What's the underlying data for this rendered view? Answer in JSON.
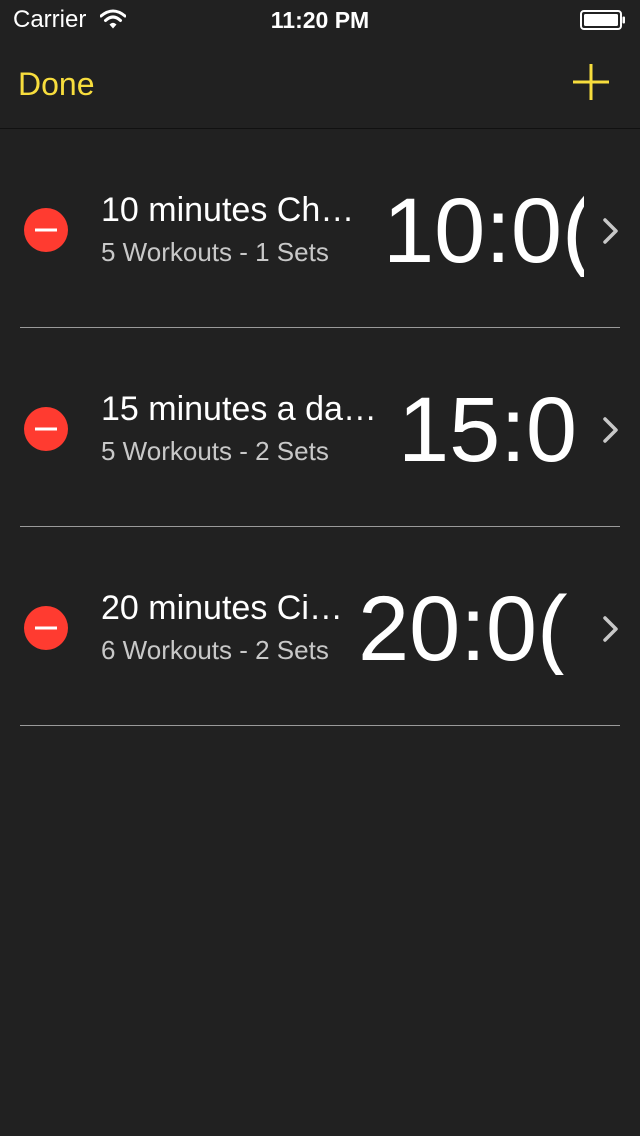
{
  "status_bar": {
    "carrier": "Carrier",
    "time": "11:20 PM",
    "icons": [
      "wifi-icon",
      "battery-icon"
    ]
  },
  "nav": {
    "done_label": "Done",
    "add_icon": "plus-icon",
    "accent_color": "#f7dd3d"
  },
  "colors": {
    "background": "#212121",
    "delete": "#ff3b30",
    "separator": "#9a9a9a"
  },
  "workouts": [
    {
      "title": "10 minutes Ch…",
      "subtitle": "5 Workouts - 1 Sets",
      "time": "10:0("
    },
    {
      "title": "15 minutes a da…",
      "subtitle": "5 Workouts - 2 Sets",
      "time": "15:0"
    },
    {
      "title": "20 minutes Ci…",
      "subtitle": "6 Workouts - 2 Sets",
      "time": "20:0("
    }
  ]
}
